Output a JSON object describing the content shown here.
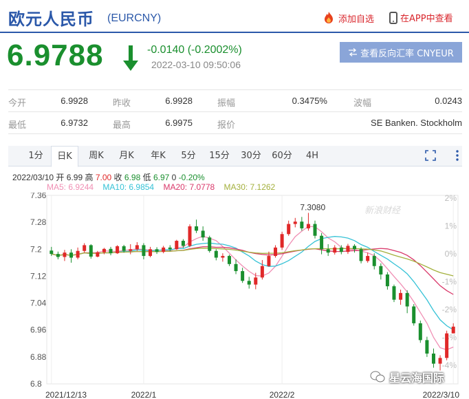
{
  "header": {
    "title": "欧元人民币",
    "symbol": "(EURCNY)",
    "watch_label": "添加自选",
    "app_label": "在APP中查看"
  },
  "quote": {
    "price": "6.9788",
    "change": "-0.0140 (-0.2002%)",
    "time": "2022-03-10 09:50:06",
    "reverse_label": "查看反向汇率 CNYEUR",
    "down_color": "#1a8f2e",
    "up_color": "#e02828"
  },
  "stats": [
    [
      {
        "label": "今开",
        "value": "6.9928"
      },
      {
        "label": "昨收",
        "value": "6.9928"
      },
      {
        "label": "振幅",
        "value": "0.3475%"
      },
      {
        "label": "波幅",
        "value": "0.0243"
      }
    ],
    [
      {
        "label": "最低",
        "value": "6.9732"
      },
      {
        "label": "最高",
        "value": "6.9975"
      },
      {
        "label": "报价",
        "value": ""
      },
      {
        "label": "",
        "value": "SE Banken. Stockholm"
      }
    ]
  ],
  "tabs": [
    "1分",
    "日K",
    "周K",
    "月K",
    "年K",
    "5分",
    "15分",
    "30分",
    "60分",
    "4H"
  ],
  "active_tab": "日K",
  "ohlc": {
    "date": "2022/03/10",
    "open_label": "开",
    "open": "6.99",
    "high_label": "高",
    "high": "7.00",
    "close_label": "收",
    "close": "6.98",
    "low_label": "低",
    "low": "6.97",
    "volume": "0",
    "pct": "-0.20%"
  },
  "ma_legend": [
    {
      "label": "MA5: 6.9244",
      "color": "#f08fb4"
    },
    {
      "label": "MA10: 6.9854",
      "color": "#35c2d6"
    },
    {
      "label": "MA20: 7.0778",
      "color": "#d9386a"
    },
    {
      "label": "MA30: 7.1262",
      "color": "#a3b03c"
    }
  ],
  "watermark": {
    "text": "星云海国际",
    "logo_text": "新浪财经"
  },
  "chart_data": {
    "type": "candlestick",
    "ylim": [
      6.8,
      7.36
    ],
    "yticks": [
      "7.36",
      "7.28",
      "7.2",
      "7.12",
      "7.04",
      "6.96",
      "6.88",
      "6.8"
    ],
    "right_ticks": [
      "2%",
      "1%",
      "0%",
      "-1%",
      "-2%",
      "-3%",
      "-4%"
    ],
    "xticks": [
      {
        "label": "2021/12/13",
        "index": 0
      },
      {
        "label": "2022/1",
        "index": 14
      },
      {
        "label": "2022/2",
        "index": 35
      },
      {
        "label": "2022/3/10",
        "index": 61
      }
    ],
    "annotation": {
      "label": "7.3080",
      "index": 39,
      "value": 7.308
    },
    "candles": [
      [
        7.196,
        7.186,
        7.207,
        7.18
      ],
      [
        7.186,
        7.177,
        7.193,
        7.17
      ],
      [
        7.177,
        7.19,
        7.198,
        7.165
      ],
      [
        7.19,
        7.175,
        7.2,
        7.16
      ],
      [
        7.175,
        7.195,
        7.205,
        7.17
      ],
      [
        7.195,
        7.212,
        7.218,
        7.19
      ],
      [
        7.212,
        7.178,
        7.215,
        7.172
      ],
      [
        7.178,
        7.191,
        7.195,
        7.176
      ],
      [
        7.191,
        7.201,
        7.204,
        7.185
      ],
      [
        7.201,
        7.188,
        7.207,
        7.182
      ],
      [
        7.188,
        7.209,
        7.212,
        7.186
      ],
      [
        7.209,
        7.195,
        7.213,
        7.19
      ],
      [
        7.195,
        7.2,
        7.215,
        7.185
      ],
      [
        7.2,
        7.212,
        7.221,
        7.195
      ],
      [
        7.212,
        7.18,
        7.218,
        7.17
      ],
      [
        7.18,
        7.2,
        7.207,
        7.176
      ],
      [
        7.2,
        7.192,
        7.206,
        7.186
      ],
      [
        7.192,
        7.205,
        7.21,
        7.188
      ],
      [
        7.205,
        7.2,
        7.212,
        7.194
      ],
      [
        7.2,
        7.225,
        7.228,
        7.198
      ],
      [
        7.225,
        7.21,
        7.23,
        7.204
      ],
      [
        7.21,
        7.268,
        7.274,
        7.206
      ],
      [
        7.268,
        7.255,
        7.288,
        7.248
      ],
      [
        7.255,
        7.235,
        7.268,
        7.225
      ],
      [
        7.235,
        7.195,
        7.24,
        7.19
      ],
      [
        7.195,
        7.175,
        7.2,
        7.167
      ],
      [
        7.175,
        7.18,
        7.188,
        7.163
      ],
      [
        7.18,
        7.156,
        7.184,
        7.15
      ],
      [
        7.156,
        7.135,
        7.17,
        7.126
      ],
      [
        7.135,
        7.106,
        7.145,
        7.1
      ],
      [
        7.106,
        7.095,
        7.118,
        7.083
      ],
      [
        7.095,
        7.116,
        7.13,
        7.081
      ],
      [
        7.116,
        7.15,
        7.168,
        7.11
      ],
      [
        7.15,
        7.18,
        7.193,
        7.148
      ],
      [
        7.18,
        7.205,
        7.212,
        7.175
      ],
      [
        7.205,
        7.245,
        7.252,
        7.198
      ],
      [
        7.245,
        7.275,
        7.285,
        7.24
      ],
      [
        7.275,
        7.282,
        7.293,
        7.265
      ],
      [
        7.282,
        7.262,
        7.296,
        7.255
      ],
      [
        7.262,
        7.275,
        7.308,
        7.255
      ],
      [
        7.275,
        7.24,
        7.285,
        7.232
      ],
      [
        7.24,
        7.2,
        7.248,
        7.185
      ],
      [
        7.2,
        7.19,
        7.215,
        7.18
      ],
      [
        7.19,
        7.205,
        7.212,
        7.184
      ],
      [
        7.205,
        7.192,
        7.212,
        7.185
      ],
      [
        7.192,
        7.21,
        7.216,
        7.186
      ],
      [
        7.21,
        7.2,
        7.215,
        7.19
      ],
      [
        7.2,
        7.165,
        7.206,
        7.158
      ],
      [
        7.165,
        7.18,
        7.19,
        7.16
      ],
      [
        7.18,
        7.15,
        7.188,
        7.14
      ],
      [
        7.15,
        7.125,
        7.158,
        7.11
      ],
      [
        7.125,
        7.09,
        7.132,
        7.08
      ],
      [
        7.09,
        7.05,
        7.095,
        7.043
      ],
      [
        7.05,
        7.07,
        7.08,
        7.035
      ],
      [
        7.07,
        7.03,
        7.078,
        7.01
      ],
      [
        7.03,
        6.98,
        7.037,
        6.973
      ],
      [
        6.98,
        6.93,
        6.988,
        6.922
      ],
      [
        6.93,
        6.89,
        6.94,
        6.88
      ],
      [
        6.89,
        6.86,
        6.905,
        6.848
      ],
      [
        6.86,
        6.877,
        6.885,
        6.84
      ],
      [
        6.877,
        6.95,
        6.958,
        6.87
      ],
      [
        6.95,
        6.97,
        6.98,
        6.955
      ]
    ]
  }
}
